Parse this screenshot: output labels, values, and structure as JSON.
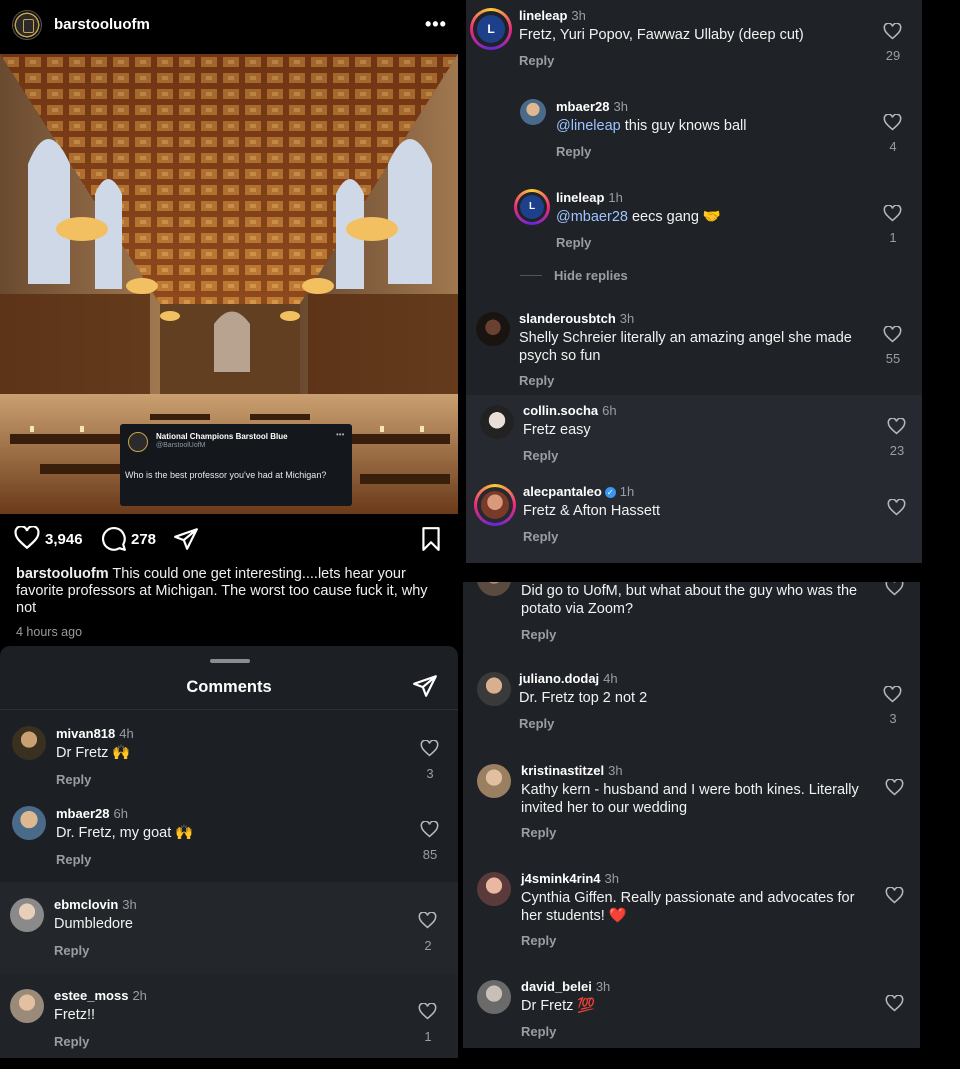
{
  "post": {
    "username": "barstooluofm",
    "likes": "3,946",
    "comments": "278",
    "caption_user": "barstooluofm",
    "caption_text": " This could one get interesting....lets hear your favorite professors at Michigan. The worst too cause fuck it, why not",
    "time": "4 hours ago",
    "tweet": {
      "name": "National Champions Barstool Blue",
      "handle": "@BarstoolUofM",
      "text": "Who is the best professor you've had at Michigan?"
    }
  },
  "comments_sheet": {
    "title": "Comments",
    "items": [
      {
        "user": "mivan818",
        "time": "4h",
        "text": "Dr Fretz 🙌",
        "reply": "Reply",
        "likes": "3"
      },
      {
        "user": "mbaer28",
        "time": "6h",
        "text": "Dr. Fretz, my goat 🙌",
        "reply": "Reply",
        "likes": "85"
      },
      {
        "user": "ebmclovin",
        "time": "3h",
        "text": "Dumbledore",
        "reply": "Reply",
        "likes": "2"
      },
      {
        "user": "estee_moss",
        "time": "2h",
        "text": "Fretz!!",
        "reply": "Reply",
        "likes": "1"
      }
    ]
  },
  "replies_panel": {
    "items": [
      {
        "user": "lineleap",
        "time": "3h",
        "text": "Fretz, Yuri Popov, Fawwaz Ullaby (deep cut)",
        "reply": "Reply",
        "likes": "29"
      },
      {
        "user": "mbaer28",
        "time": "3h",
        "mention": "@lineleap",
        "text": " this guy knows ball",
        "reply": "Reply",
        "likes": "4"
      },
      {
        "user": "lineleap",
        "time": "1h",
        "mention": "@mbaer28",
        "text": " eecs gang 🤝",
        "reply": "Reply",
        "likes": "1"
      },
      {
        "user": "slanderousbtch",
        "time": "3h",
        "text": "Shelly Schreier literally an amazing angel she made psych so fun",
        "reply": "Reply",
        "likes": "55"
      },
      {
        "user": "collin.socha",
        "time": "6h",
        "text": "Fretz easy",
        "reply": "Reply",
        "likes": "23"
      },
      {
        "user": "alecpantaleo",
        "time": "1h",
        "text": "Fretz & Afton Hassett",
        "reply": "Reply",
        "likes": ""
      }
    ],
    "hide_replies": "Hide replies",
    "avatar_logo_text": "L"
  },
  "list_panel": {
    "items": [
      {
        "user": "",
        "time": "",
        "text": "Did go to UofM, but what about the guy who was the potato via Zoom?",
        "reply": "Reply",
        "likes": ""
      },
      {
        "user": "juliano.dodaj",
        "time": "4h",
        "text": "Dr. Fretz top 2 not 2",
        "reply": "Reply",
        "likes": "3"
      },
      {
        "user": "kristinastitzel",
        "time": "3h",
        "text": "Kathy kern - husband and I were both kines. Literally invited her to our wedding",
        "reply": "Reply",
        "likes": ""
      },
      {
        "user": "j4smink4rin4",
        "time": "3h",
        "text": "Cynthia Giffen. Really passionate and advocates for her students! ❤️",
        "reply": "Reply",
        "likes": ""
      },
      {
        "user": "david_belei",
        "time": "3h",
        "text": "Dr Fretz 💯",
        "reply": "Reply",
        "likes": ""
      }
    ]
  },
  "colors": {
    "background": "#000000",
    "panel": "#1f2227",
    "mention": "#9cc4ff",
    "muted": "#9a9da2"
  },
  "icons": [
    "more-icon",
    "heart-icon",
    "comment-icon",
    "send-icon",
    "bookmark-icon",
    "verified-icon"
  ]
}
